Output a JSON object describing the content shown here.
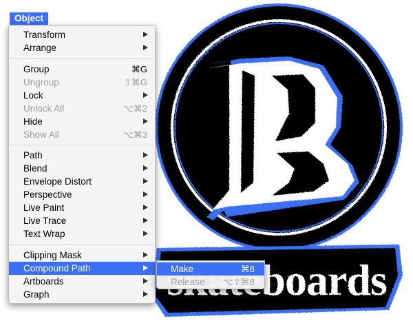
{
  "menubar": {
    "title": "Object"
  },
  "artwork": {
    "logo_letter": "B",
    "logo_text": "skateboards",
    "ring_color": "#000000",
    "accent_color": "#3b6ff5"
  },
  "menu": {
    "items": [
      {
        "label": "Transform",
        "shortcut": "",
        "submenu": true,
        "disabled": false
      },
      {
        "label": "Arrange",
        "shortcut": "",
        "submenu": true,
        "disabled": false
      },
      {
        "label": "Group",
        "shortcut": "⌘G",
        "submenu": false,
        "disabled": false
      },
      {
        "label": "Ungroup",
        "shortcut": "⇧⌘G",
        "submenu": false,
        "disabled": true
      },
      {
        "label": "Lock",
        "shortcut": "",
        "submenu": true,
        "disabled": false
      },
      {
        "label": "Unlock All",
        "shortcut": "⌥⌘2",
        "submenu": false,
        "disabled": true
      },
      {
        "label": "Hide",
        "shortcut": "",
        "submenu": true,
        "disabled": false
      },
      {
        "label": "Show All",
        "shortcut": "⌥⌘3",
        "submenu": false,
        "disabled": true
      },
      {
        "label": "Path",
        "shortcut": "",
        "submenu": true,
        "disabled": false
      },
      {
        "label": "Blend",
        "shortcut": "",
        "submenu": true,
        "disabled": false
      },
      {
        "label": "Envelope Distort",
        "shortcut": "",
        "submenu": true,
        "disabled": false
      },
      {
        "label": "Perspective",
        "shortcut": "",
        "submenu": true,
        "disabled": false
      },
      {
        "label": "Live Paint",
        "shortcut": "",
        "submenu": true,
        "disabled": false
      },
      {
        "label": "Live Trace",
        "shortcut": "",
        "submenu": true,
        "disabled": false
      },
      {
        "label": "Text Wrap",
        "shortcut": "",
        "submenu": true,
        "disabled": false
      },
      {
        "label": "Clipping Mask",
        "shortcut": "",
        "submenu": true,
        "disabled": false
      },
      {
        "label": "Compound Path",
        "shortcut": "",
        "submenu": true,
        "disabled": false,
        "highlighted": true
      },
      {
        "label": "Artboards",
        "shortcut": "",
        "submenu": true,
        "disabled": false
      },
      {
        "label": "Graph",
        "shortcut": "",
        "submenu": true,
        "disabled": false
      }
    ]
  },
  "submenu": {
    "items": [
      {
        "label": "Make",
        "shortcut": "⌘8",
        "disabled": false,
        "highlighted": true
      },
      {
        "label": "Release",
        "shortcut": "⌥⇧⌘8",
        "disabled": true
      }
    ]
  }
}
